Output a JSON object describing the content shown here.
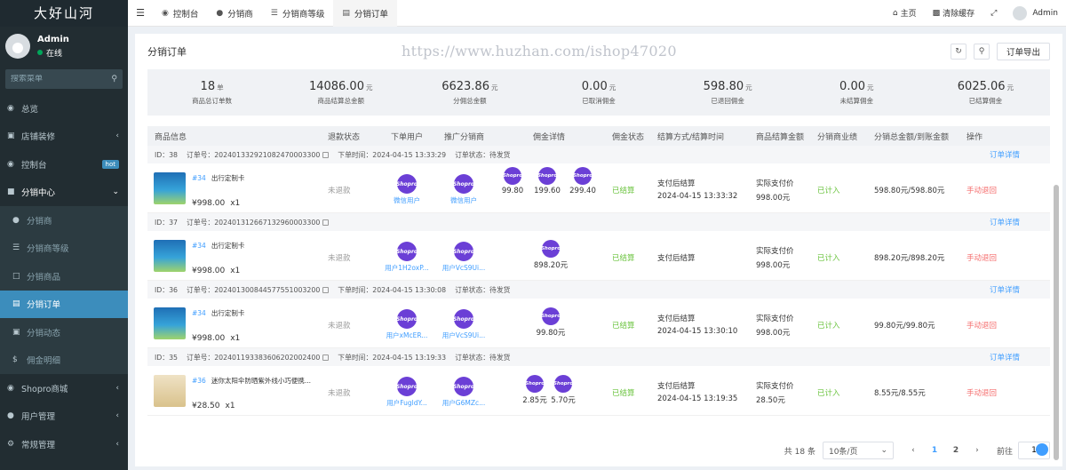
{
  "sidebar": {
    "brand": "大好山河",
    "user": {
      "name": "Admin",
      "status": "在线"
    },
    "search_placeholder": "搜索菜单",
    "items": [
      {
        "label": "总览",
        "icon": "dashboard-icon"
      },
      {
        "label": "店铺装修",
        "icon": "shop-icon"
      },
      {
        "label": "控制台",
        "icon": "console-icon",
        "badge": "hot"
      },
      {
        "label": "分销中心",
        "icon": "group-icon"
      }
    ],
    "submenu": [
      {
        "label": "分销商",
        "icon": "user-icon"
      },
      {
        "label": "分销商等级",
        "icon": "list-icon"
      },
      {
        "label": "分销商品",
        "icon": "goods-icon"
      },
      {
        "label": "分销订单",
        "icon": "file-icon"
      },
      {
        "label": "分销动态",
        "icon": "activity-icon"
      },
      {
        "label": "佣金明细",
        "icon": "dollar-icon"
      }
    ],
    "bottom_items": [
      {
        "label": "Shopro商城",
        "icon": "store-icon"
      },
      {
        "label": "用户管理",
        "icon": "users-icon"
      },
      {
        "label": "常规管理",
        "icon": "settings-icon"
      }
    ]
  },
  "topbar": {
    "tabs": [
      {
        "label": "控制台",
        "icon": "dashboard-icon"
      },
      {
        "label": "分销商",
        "icon": "user-icon"
      },
      {
        "label": "分销商等级",
        "icon": "list-icon"
      },
      {
        "label": "分销订单",
        "icon": "file-icon"
      }
    ],
    "home": "主页",
    "clear_cache": "清除缓存",
    "admin": "Admin"
  },
  "panel": {
    "title": "分销订单",
    "watermark": "https://www.huzhan.com/ishop47020",
    "export_label": "订单导出"
  },
  "stats": [
    {
      "value": "18",
      "unit": "单",
      "label": "商品总订单数"
    },
    {
      "value": "14086.00",
      "unit": "元",
      "label": "商品结算总金额"
    },
    {
      "value": "6623.86",
      "unit": "元",
      "label": "分佣总金额"
    },
    {
      "value": "0.00",
      "unit": "元",
      "label": "已取消佣金"
    },
    {
      "value": "598.80",
      "unit": "元",
      "label": "已退回佣金"
    },
    {
      "value": "0.00",
      "unit": "元",
      "label": "未结算佣金"
    },
    {
      "value": "6025.06",
      "unit": "元",
      "label": "已结算佣金"
    }
  ],
  "columns": [
    "商品信息",
    "退款状态",
    "下单用户",
    "推广分销商",
    "佣金详情",
    "佣金状态",
    "结算方式/结算时间",
    "商品结算金额",
    "分销商业绩",
    "分销总金额/到账金额",
    "操作"
  ],
  "orders": [
    {
      "id": "ID：38",
      "order_no": "订单号：2024013329210824700033​00",
      "order_time": "下单时间：2024-04-15 13:33:29",
      "order_status": "订单状态：待发货",
      "goods_id": "#34",
      "goods_name": "出行定制卡",
      "price": "¥998.00",
      "qty": "x1",
      "refund": "未退款",
      "buyer": "微信用户",
      "agent": "微信用户",
      "commissions": [
        "99.80",
        "199.60",
        "299.40"
      ],
      "comm_status": "已结算",
      "settle_method": "支付后结算",
      "settle_time": "2024-04-15 13:33:32",
      "settle_amount_label": "实际支付价",
      "settle_amount": "998.00元",
      "performance": "已计入",
      "total": "598.80元/598.80元",
      "action": "手动退回",
      "detail": "订单详情"
    },
    {
      "id": "ID：37",
      "order_no": "订单号：2024013126671329600033​00",
      "order_time": "",
      "order_status": "",
      "goods_id": "#34",
      "goods_name": "出行定制卡",
      "price": "¥998.00",
      "qty": "x1",
      "refund": "未退款",
      "buyer": "用户1H2oxP...",
      "agent": "用户VcS9Ui...",
      "commissions": [
        "898.20元"
      ],
      "comm_status": "已结算",
      "settle_method": "支付后结算",
      "settle_time": "",
      "settle_amount_label": "实际支付价",
      "settle_amount": "998.00元",
      "performance": "已计入",
      "total": "898.20元/898.20元",
      "action": "手动退回",
      "detail": "订单详情"
    },
    {
      "id": "ID：36",
      "order_no": "订单号：2024013008445775510032​00",
      "order_time": "下单时间：2024-04-15 13:30:08",
      "order_status": "订单状态：待发货",
      "goods_id": "#34",
      "goods_name": "出行定制卡",
      "price": "¥998.00",
      "qty": "x1",
      "refund": "未退款",
      "buyer": "用户xMcER...",
      "agent": "用户VcS9Ui...",
      "commissions": [
        "99.80元"
      ],
      "comm_status": "已结算",
      "settle_method": "支付后结算",
      "settle_time": "2024-04-15 13:30:10",
      "settle_amount_label": "实际支付价",
      "settle_amount": "998.00元",
      "performance": "已计入",
      "total": "99.80元/99.80元",
      "action": "手动退回",
      "detail": "订单详情"
    },
    {
      "id": "ID：35",
      "order_no": "订单号：2024011933836062020024​00",
      "order_time": "下单时间：2024-04-15 13:19:33",
      "order_status": "订单状态：待发货",
      "goods_id": "#36",
      "goods_name": "迷你太阳伞防晒紫外线小巧便携...",
      "price": "¥28.50",
      "qty": "x1",
      "refund": "未退款",
      "buyer": "用户FugldY...",
      "agent": "用户G6MZc...",
      "commissions": [
        "2.85元",
        "5.70元"
      ],
      "comm_status": "已结算",
      "settle_method": "支付后结算",
      "settle_time": "2024-04-15 13:19:35",
      "settle_amount_label": "实际支付价",
      "settle_amount": "28.50元",
      "performance": "已计入",
      "total": "8.55元/8.55元",
      "action": "手动退回",
      "detail": "订单详情"
    }
  ],
  "shopro_label": "Shopro",
  "pager": {
    "total": "共 18 条",
    "size": "10条/页",
    "prev": "‹",
    "pages": [
      "1",
      "2"
    ],
    "next": "›",
    "goto_label": "前往",
    "goto_value": "1"
  }
}
